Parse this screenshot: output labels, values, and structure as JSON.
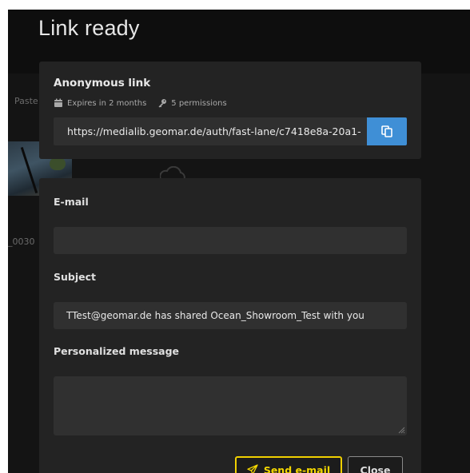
{
  "dialog": {
    "title": "Link ready"
  },
  "background": {
    "paste_label": "Paste",
    "filename_fragment": "_0030"
  },
  "link_card": {
    "heading": "Anonymous link",
    "expires_text": "Expires in 2 months",
    "permissions_text": "5 permissions",
    "url": "https://medialib.geomar.de/auth/fast-lane/c7418e8a-20a1-",
    "icons": {
      "expires": "calendar-icon",
      "permissions": "key-icon",
      "copy": "copy-icon"
    }
  },
  "form": {
    "email_label": "E-mail",
    "email_value": "",
    "subject_label": "Subject",
    "subject_value": "TTest@geomar.de has shared Ocean_Showroom_Test with you",
    "message_label": "Personalized message",
    "message_value": ""
  },
  "actions": {
    "send_label": "Send e-mail",
    "close_label": "Close",
    "send_icon": "paper-plane-icon"
  },
  "colors": {
    "accent_yellow": "#f0d000",
    "copy_blue": "#3f8fd6",
    "card_bg": "#232323",
    "overlay_bg": "#141414"
  }
}
